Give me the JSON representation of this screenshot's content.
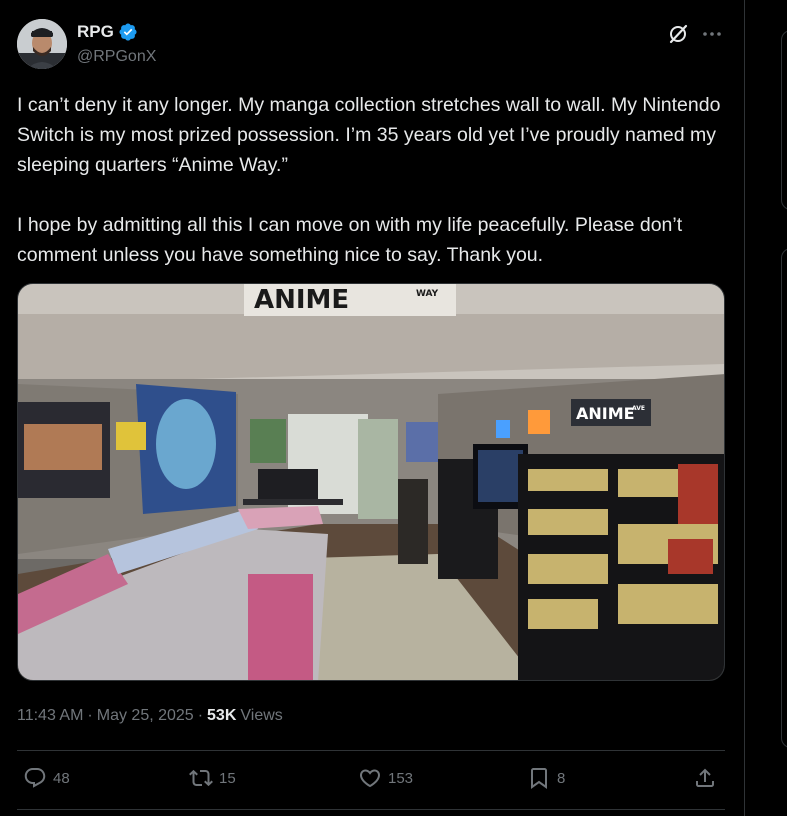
{
  "author": {
    "name": "RPG",
    "handle": "@RPGonX",
    "verified": true,
    "verified_color": "#1d9bf0"
  },
  "header_icons": [
    "grok-icon",
    "more-icon"
  ],
  "tweet": {
    "text": "I can’t deny it any longer. My manga collection stretches wall to wall. My Nintendo Switch is my most prized possession. I’m 35 years old yet I’ve proudly named my sleeping quarters “Anime Way.”\n\nI hope by admitting all this I can move on with my life peacefully. Please don’t comment unless you have something nice to say. Thank you.",
    "photo_sign_text": "ANIME",
    "photo_sign_small": "WAY",
    "photo_sign2_text": "ANIME",
    "photo_sign2_small": "AVE"
  },
  "meta": {
    "time": "11:43 AM",
    "separator": "·",
    "date": "May 25, 2025",
    "separator2": "·",
    "views_count": "53K",
    "views_label": "Views"
  },
  "actions": {
    "replies": "48",
    "reposts": "15",
    "likes": "153",
    "bookmarks": "8"
  },
  "colors": {
    "background": "#000000",
    "text": "#e7e9ea",
    "secondary": "#71767b",
    "border": "#2f3336",
    "accent": "#1d9bf0"
  }
}
